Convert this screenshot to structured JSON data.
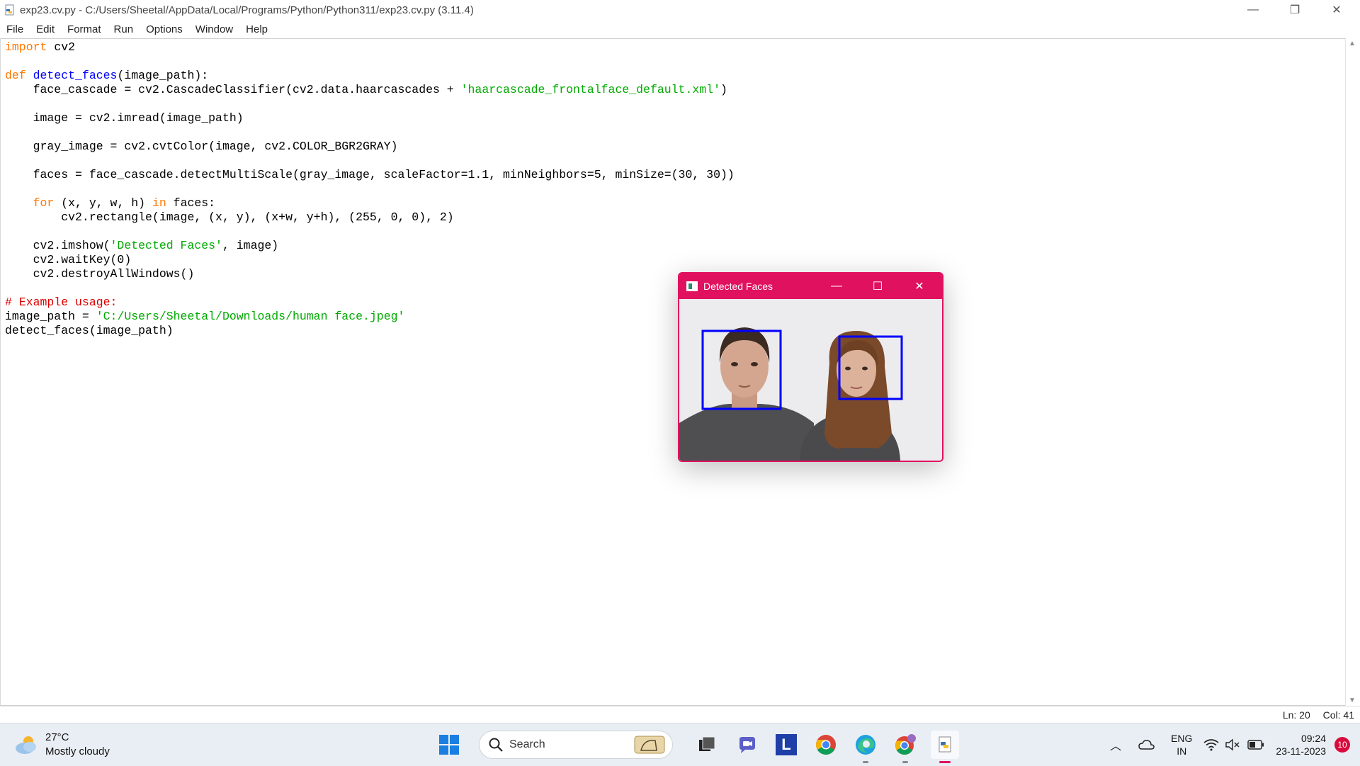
{
  "window": {
    "title": "exp23.cv.py - C:/Users/Sheetal/AppData/Local/Programs/Python/Python311/exp23.cv.py (3.11.4)",
    "minimize": "—",
    "restore": "❐",
    "close": "✕"
  },
  "menu": [
    "File",
    "Edit",
    "Format",
    "Run",
    "Options",
    "Window",
    "Help"
  ],
  "code": {
    "lines": [
      [
        {
          "t": "import",
          "c": "kw"
        },
        {
          "t": " cv2"
        }
      ],
      [],
      [
        {
          "t": "def",
          "c": "kw"
        },
        {
          "t": " "
        },
        {
          "t": "detect_faces",
          "c": "fn"
        },
        {
          "t": "(image_path):"
        }
      ],
      [
        {
          "t": "    face_cascade = cv2.CascadeClassifier(cv2.data.haarcascades + "
        },
        {
          "t": "'haarcascade_frontalface_default.xml'",
          "c": "str"
        },
        {
          "t": ")"
        }
      ],
      [],
      [
        {
          "t": "    image = cv2.imread(image_path)"
        }
      ],
      [],
      [
        {
          "t": "    gray_image = cv2.cvtColor(image, cv2.COLOR_BGR2GRAY)"
        }
      ],
      [],
      [
        {
          "t": "    faces = face_cascade.detectMultiScale(gray_image, scaleFactor=1.1, minNeighbors=5, minSize=(30, 30))"
        }
      ],
      [],
      [
        {
          "t": "    "
        },
        {
          "t": "for",
          "c": "kw"
        },
        {
          "t": " (x, y, w, h) "
        },
        {
          "t": "in",
          "c": "kw"
        },
        {
          "t": " faces:"
        }
      ],
      [
        {
          "t": "        cv2.rectangle(image, (x, y), (x+w, y+h), (255, 0, 0), 2)"
        }
      ],
      [],
      [
        {
          "t": "    cv2.imshow("
        },
        {
          "t": "'Detected Faces'",
          "c": "str"
        },
        {
          "t": ", image)"
        }
      ],
      [
        {
          "t": "    cv2.waitKey(0)"
        }
      ],
      [
        {
          "t": "    cv2.destroyAllWindows()"
        }
      ],
      [],
      [
        {
          "t": "# Example usage:",
          "c": "cm"
        }
      ],
      [
        {
          "t": "image_path = "
        },
        {
          "t": "'C:/Users/Sheetal/Downloads/human face.jpeg'",
          "c": "str"
        }
      ],
      [
        {
          "t": "detect_faces(image_path)"
        }
      ]
    ]
  },
  "status": {
    "line": "Ln: 20",
    "col": "Col: 41"
  },
  "cv_window": {
    "title": "Detected Faces",
    "minimize": "—",
    "maximize": "☐",
    "close": "✕",
    "box_color": "#0000ff"
  },
  "taskbar": {
    "weather_temp": "27°C",
    "weather_desc": "Mostly cloudy",
    "search_label": "Search",
    "lang_top": "ENG",
    "lang_bottom": "IN",
    "time": "09:24",
    "date": "23-11-2023",
    "notifications": "10",
    "app_l_label": "L"
  },
  "colors": {
    "accent": "#e0115f",
    "keyword": "#ff7700",
    "string": "#00aa00",
    "comment": "#dd0000",
    "function": "#0000ff"
  }
}
